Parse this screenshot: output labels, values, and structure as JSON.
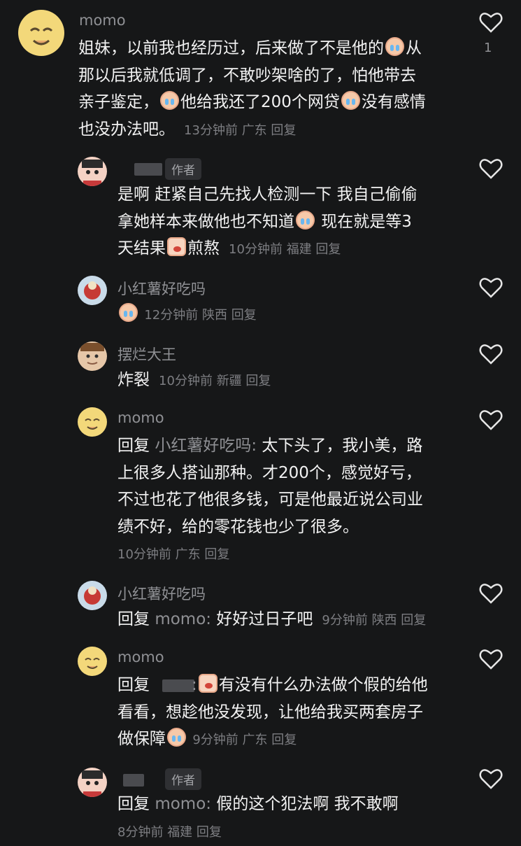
{
  "comments": [
    {
      "user": "momo",
      "text1": "姐妹，以前我也经历过，后来做了不是他的",
      "text2": "从",
      "text3": "那以后我就低调了，不敢吵架啥的了，怕他带去",
      "text4": "亲子鉴定，",
      "text5": "他给我还了200个网贷",
      "text6": "没有感情",
      "text7": "也没办法吧。",
      "time": "13分钟前",
      "loc": "广东",
      "reply": "回复",
      "likes": "1"
    },
    {
      "author": "作者",
      "text1": "是啊 赶紧自己先找人检测一下  我自己偷偷",
      "text2": "拿她样本来做他也不知道",
      "text3": " 现在就是等3",
      "text4": "天结果",
      "text5": "煎熬",
      "time": "10分钟前",
      "loc": "福建",
      "reply": "回复"
    },
    {
      "user": "小红薯好吃吗",
      "time": "12分钟前",
      "loc": "陕西",
      "reply": "回复"
    },
    {
      "user": "摆烂大王",
      "text": "炸裂",
      "time": "10分钟前",
      "loc": "新疆",
      "reply": "回复"
    },
    {
      "user": "momo",
      "prefix": "回复",
      "target": "小红薯好吃吗:",
      "text1": " 太下头了，我小美，路",
      "text2": "上很多人搭讪那种。才200个，感觉好亏，",
      "text3": "不过也花了他很多钱，可是他最近说公司业",
      "text4": "绩不好，给的零花钱也少了很多。",
      "time": "10分钟前",
      "loc": "广东",
      "reply": "回复"
    },
    {
      "user": "小红薯好吃吗",
      "prefix": "回复",
      "target": "momo:",
      "text": " 好好过日子吧",
      "time": "9分钟前",
      "loc": "陕西",
      "reply": "回复"
    },
    {
      "user": "momo",
      "prefix": "回复",
      "target": ":",
      "text1": "有没有什么办法做个假的给他",
      "text2": "看看，想趁他没发现，让他给我买两套房子",
      "text3": "做保障",
      "time": "9分钟前",
      "loc": "广东",
      "reply": "回复"
    },
    {
      "author": "作者",
      "prefix": "回复",
      "target": "momo:",
      "text": " 假的这个犯法啊  我不敢啊",
      "time": "8分钟前",
      "loc": "福建",
      "reply": "回复"
    }
  ],
  "icons": {
    "like": "heart-outline-icon",
    "cry": "crying-emoji-icon",
    "sob": "sob-sticker-icon"
  }
}
